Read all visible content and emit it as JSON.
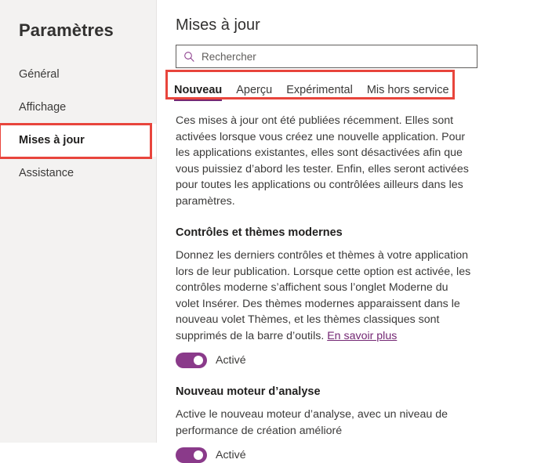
{
  "sidebar": {
    "title": "Paramètres",
    "items": [
      {
        "label": "Général",
        "selected": false
      },
      {
        "label": "Affichage",
        "selected": false
      },
      {
        "label": "Mises à jour",
        "selected": true
      },
      {
        "label": "Assistance",
        "selected": false
      }
    ]
  },
  "main": {
    "page_title": "Mises à jour",
    "search": {
      "icon": "search-icon",
      "placeholder": "Rechercher",
      "value": ""
    },
    "tabs": [
      {
        "label": "Nouveau",
        "active": true
      },
      {
        "label": "Aperçu",
        "active": false
      },
      {
        "label": "Expérimental",
        "active": false
      },
      {
        "label": "Mis hors service",
        "active": false
      }
    ],
    "intro": "Ces mises à jour ont été publiées récemment. Elles sont activées lorsque vous créez une nouvelle application. Pour les applications existantes, elles sont désactivées afin que vous puissiez d’abord les tester. Enfin, elles seront activées pour toutes les applications ou contrôlées ailleurs dans les paramètres.",
    "sections": [
      {
        "title": "Contrôles et thèmes modernes",
        "description": "Donnez les derniers contrôles et thèmes à votre application lors de leur publication. Lorsque cette option est activée, les contrôles moderne s’affichent sous l’onglet Moderne du volet Insérer. Des thèmes modernes apparaissent dans le nouveau volet Thèmes, et les thèmes classiques sont supprimés de la barre d’outils. ",
        "link_label": "En savoir plus",
        "toggle_label": "Activé",
        "toggle_on": true
      },
      {
        "title": "Nouveau moteur d’analyse",
        "description": "Active le nouveau moteur d’analyse, avec un niveau de performance de création amélioré",
        "link_label": "",
        "toggle_label": "Activé",
        "toggle_on": true
      }
    ]
  },
  "colors": {
    "accent_purple": "#742774",
    "toggle_purple": "#8a3a8a",
    "annotation_red": "#e8453c",
    "sidebar_bg": "#f3f2f1",
    "text": "#3b3a39"
  }
}
